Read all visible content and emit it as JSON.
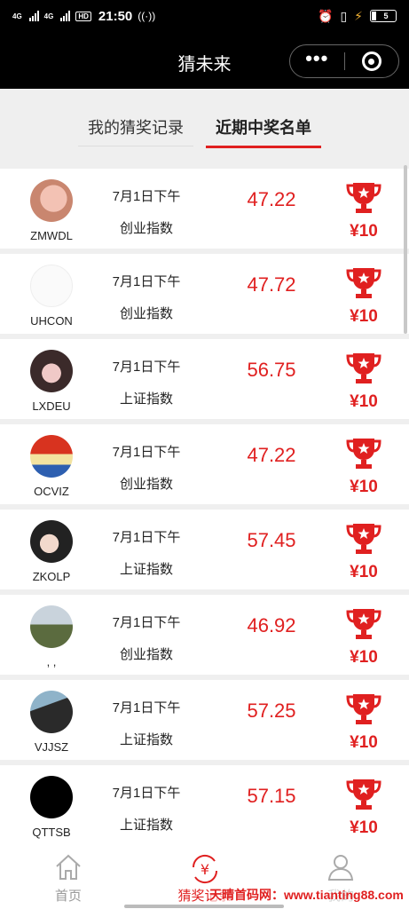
{
  "status": {
    "net1": "4G",
    "net2": "4G",
    "hd": "HD",
    "time": "21:50",
    "battery": "5"
  },
  "header": {
    "title": "猜未来",
    "more": "•••"
  },
  "tabs": [
    {
      "label": "我的猜奖记录",
      "active": false
    },
    {
      "label": "近期中奖名单",
      "active": true
    }
  ],
  "winners": [
    {
      "name": "ZMWDL",
      "date": "7月1日下午",
      "index": "创业指数",
      "value": "47.22",
      "prize": "¥10"
    },
    {
      "name": "UHCON",
      "date": "7月1日下午",
      "index": "创业指数",
      "value": "47.72",
      "prize": "¥10"
    },
    {
      "name": "LXDEU",
      "date": "7月1日下午",
      "index": "上证指数",
      "value": "56.75",
      "prize": "¥10"
    },
    {
      "name": "OCVIZ",
      "date": "7月1日下午",
      "index": "创业指数",
      "value": "47.22",
      "prize": "¥10"
    },
    {
      "name": "ZKOLP",
      "date": "7月1日下午",
      "index": "上证指数",
      "value": "57.45",
      "prize": "¥10"
    },
    {
      "name": ", ,",
      "date": "7月1日下午",
      "index": "创业指数",
      "value": "46.92",
      "prize": "¥10"
    },
    {
      "name": "VJJSZ",
      "date": "7月1日下午",
      "index": "上证指数",
      "value": "57.25",
      "prize": "¥10"
    },
    {
      "name": "QTTSB",
      "date": "7月1日下午",
      "index": "上证指数",
      "value": "57.15",
      "prize": "¥10"
    }
  ],
  "nav": [
    {
      "label": "首页",
      "icon": "home-icon"
    },
    {
      "label": "猜奖记录",
      "icon": "yuan-refresh-icon"
    },
    {
      "label": "我的",
      "icon": "user-icon"
    }
  ],
  "watermark": "天晴首码网：www.tianting88.com",
  "colors": {
    "accent": "#e02020",
    "header_bg": "#000000",
    "page_bg": "#efefef"
  }
}
